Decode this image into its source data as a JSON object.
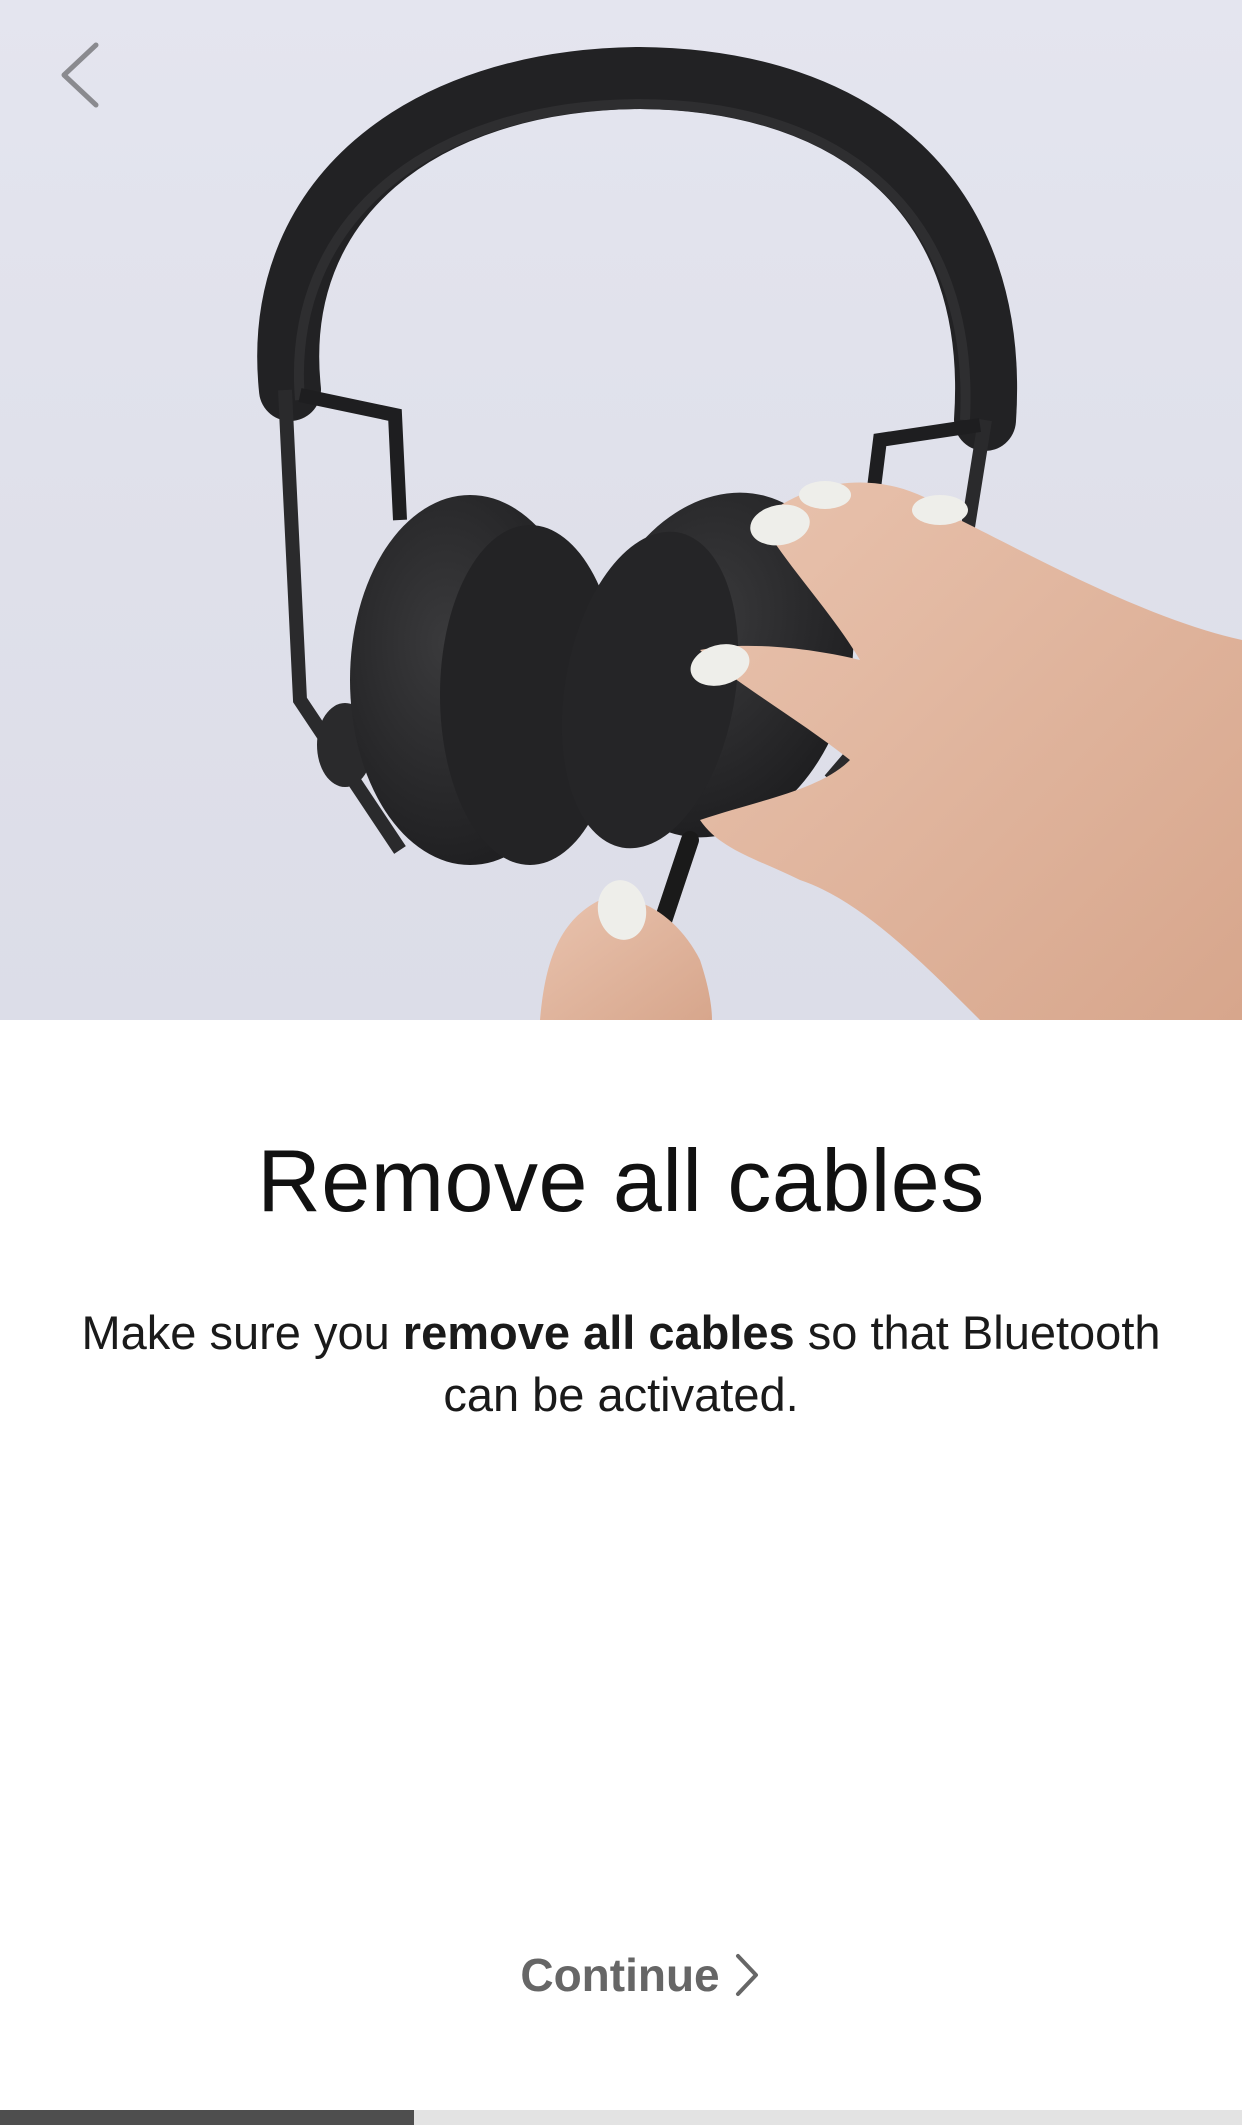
{
  "hero": {
    "image": "headphones-cable-removal-photo"
  },
  "header": {
    "back_icon": "chevron-left-icon"
  },
  "content": {
    "title": "Remove all cables",
    "description_prefix": "Make sure you ",
    "description_bold": "remove all cables",
    "description_suffix": " so that Bluetooth can be activated."
  },
  "footer": {
    "continue_label": "Continue",
    "continue_icon": "chevron-right-icon"
  },
  "progress": {
    "value": 0.333
  },
  "colors": {
    "title": "#111111",
    "continue": "#666666",
    "progress_fill": "#4e4e4e",
    "progress_track": "#e3e3e3"
  }
}
